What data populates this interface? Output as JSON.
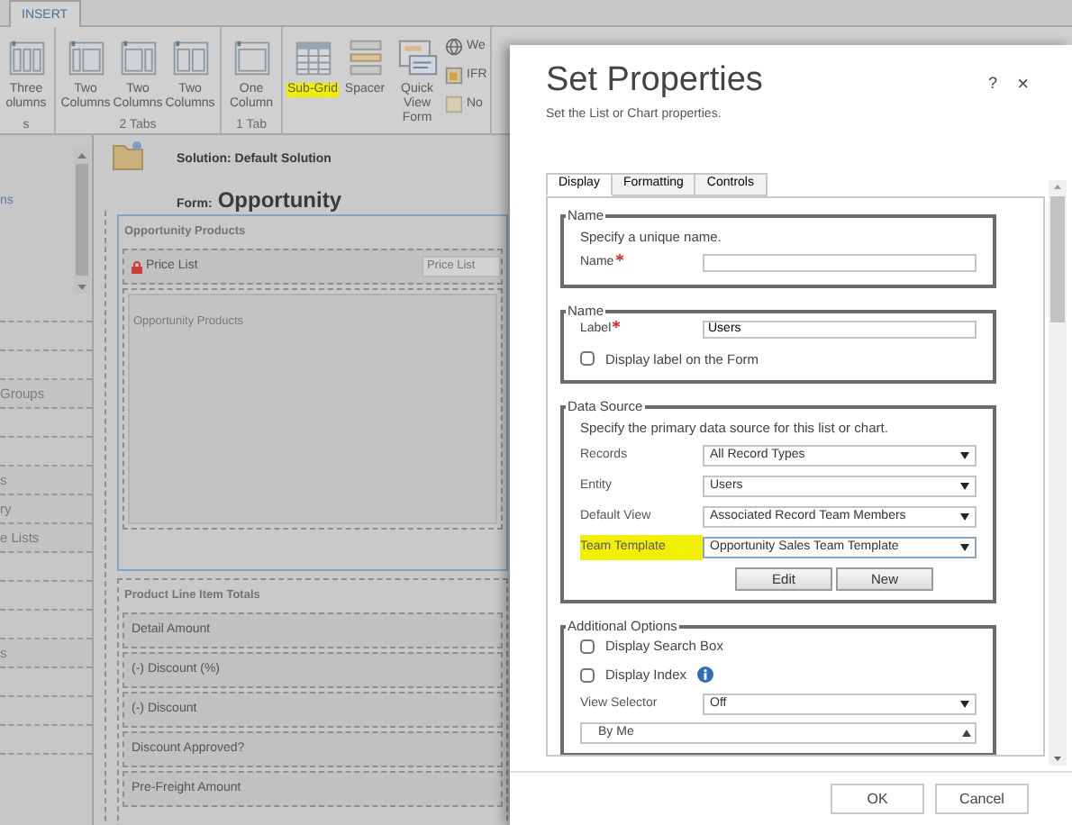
{
  "ribbon": {
    "tabs": [
      {
        "label": "INSERT",
        "selected": true
      }
    ],
    "groups": [
      {
        "label": "s",
        "buttons": [
          {
            "kind": "three-columns",
            "label": "Three olumns",
            "highlighted": false
          }
        ]
      },
      {
        "label": "2 Tabs",
        "buttons": [
          {
            "kind": "two-columns-a",
            "label": "Two Columns",
            "highlighted": false
          },
          {
            "kind": "two-columns-b",
            "label": "Two Columns",
            "highlighted": false
          },
          {
            "kind": "two-columns-c",
            "label": "Two Columns",
            "highlighted": false
          }
        ]
      },
      {
        "label": "1 Tab",
        "buttons": [
          {
            "kind": "one-column",
            "label": "One Column",
            "highlighted": false
          }
        ]
      },
      {
        "buttons": [
          {
            "kind": "sub-grid",
            "label": "Sub-Grid",
            "highlighted": true
          },
          {
            "kind": "spacer",
            "label": "Spacer",
            "highlighted": false
          },
          {
            "kind": "quick-view",
            "label": "Quick View Form",
            "highlighted": false
          }
        ],
        "small_buttons": [
          {
            "kind": "web-resource",
            "label": "We"
          },
          {
            "kind": "iframe",
            "label": "IFR"
          },
          {
            "kind": "notes",
            "label": "No"
          }
        ]
      }
    ]
  },
  "sidebar": {
    "top_item": "ns",
    "rows": [
      {
        "kind": "blank"
      },
      {
        "kind": "blank"
      },
      {
        "kind": "blank"
      },
      {
        "kind": "item",
        "label": "Groups"
      },
      {
        "kind": "blank"
      },
      {
        "kind": "blank"
      },
      {
        "kind": "item",
        "label": "s"
      },
      {
        "kind": "item",
        "label": "ry"
      },
      {
        "kind": "item",
        "label": "e Lists"
      },
      {
        "kind": "blank"
      },
      {
        "kind": "blank"
      },
      {
        "kind": "blank"
      },
      {
        "kind": "item",
        "label": "s"
      },
      {
        "kind": "blank"
      },
      {
        "kind": "blank"
      },
      {
        "kind": "blank"
      }
    ]
  },
  "form_header": {
    "solution": "Solution: Default Solution",
    "form_label": "Form:",
    "form_name": "Opportunity"
  },
  "sections": [
    {
      "title": "Opportunity Products",
      "selected": true,
      "fields": [
        {
          "label": "Price List",
          "locked": true,
          "placeholder": "Price List"
        }
      ],
      "subgrid": "Opportunity Products"
    },
    {
      "title": "Product Line Item Totals",
      "selected": false,
      "rows": [
        "Detail Amount",
        "(-) Discount (%)",
        "(-) Discount",
        "Discount Approved?",
        "Pre-Freight Amount"
      ]
    }
  ],
  "dialog": {
    "title": "Set Properties",
    "subtitle": "Set the List or Chart properties.",
    "help": "?",
    "close": "×",
    "tabs": [
      {
        "label": "Display",
        "selected": true
      },
      {
        "label": "Formatting",
        "selected": false
      },
      {
        "label": "Controls",
        "selected": false
      }
    ],
    "fieldsets": [
      {
        "legend": "Name",
        "note": "Specify a unique name.",
        "fields": [
          {
            "kind": "text",
            "label": "Name",
            "required": true
          }
        ]
      },
      {
        "legend": "Name",
        "fields": [
          {
            "kind": "text",
            "label": "Label",
            "required": true,
            "value": "Users"
          },
          {
            "kind": "checkbox",
            "label": "Display label on the Form",
            "checked": false
          }
        ]
      },
      {
        "legend": "Data Source",
        "note": "Specify the primary data source for this list or chart.",
        "fields": [
          {
            "kind": "select",
            "label": "Records",
            "value": "All Record Types",
            "highlighted": false
          },
          {
            "kind": "select",
            "label": "Entity",
            "value": "Users",
            "highlighted": false
          },
          {
            "kind": "select",
            "label": "Default View",
            "value": "Associated Record Team Members",
            "highlighted": false
          },
          {
            "kind": "select",
            "label": "Team Template",
            "value": "Opportunity Sales Team Template",
            "highlighted": true
          }
        ],
        "buttons": [
          "Edit",
          "New"
        ]
      },
      {
        "legend": "Additional Options",
        "fields": [
          {
            "kind": "checkbox",
            "label": "Display Search Box",
            "checked": false
          },
          {
            "kind": "checkbox",
            "label": "Display Index",
            "checked": false,
            "info": true
          },
          {
            "kind": "select",
            "label": "View Selector",
            "value": "Off",
            "highlighted": false
          },
          {
            "kind": "listbox",
            "items": [
              "By Me"
            ]
          }
        ]
      }
    ],
    "buttons": [
      "OK",
      "Cancel"
    ]
  }
}
